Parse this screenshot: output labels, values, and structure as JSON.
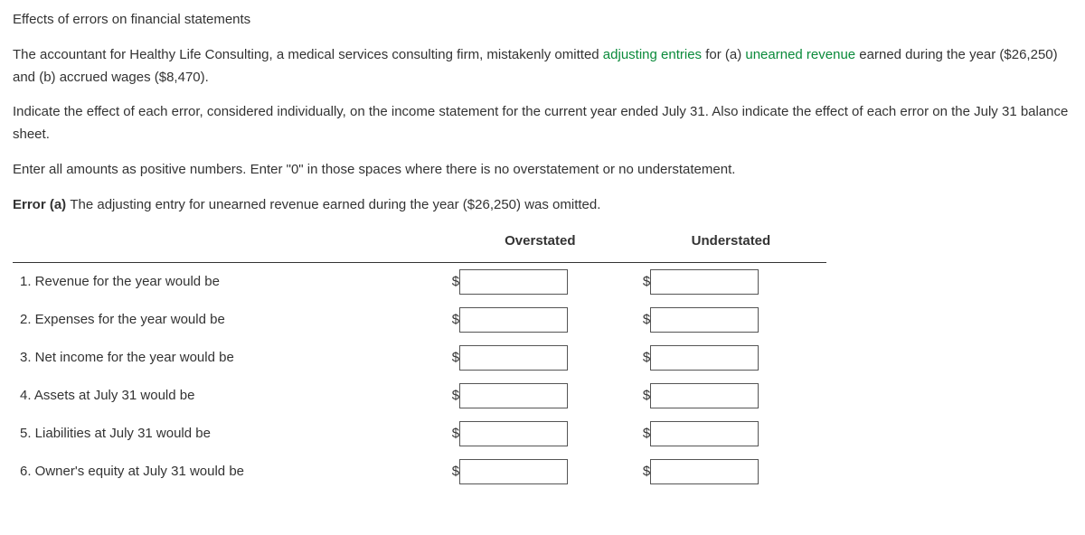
{
  "title": "Effects of errors on financial statements",
  "para1_pre": "The accountant for Healthy Life Consulting, a medical services consulting firm, mistakenly omitted ",
  "link1": "adjusting entries",
  "para1_mid": " for (a) ",
  "link2": "unearned revenue",
  "para1_post": " earned during the year ($26,250) and (b) accrued wages ($8,470).",
  "para2": "Indicate the effect of each error, considered individually, on the income statement for the current year ended July 31. Also indicate the effect of each error on the July 31 balance sheet.",
  "para3": "Enter all amounts as positive numbers. Enter \"0\" in those spaces where there is no overstatement or no understatement.",
  "error_a_label": "Error (a) ",
  "error_a_text": "The adjusting entry for unearned revenue earned during the year ($26,250) was omitted.",
  "columns": {
    "overstated": "Overstated",
    "understated": "Understated"
  },
  "currency": "$",
  "rows": [
    {
      "label": "1. Revenue for the year would be",
      "over": "",
      "under": ""
    },
    {
      "label": "2. Expenses for the year would be",
      "over": "",
      "under": ""
    },
    {
      "label": "3. Net income for the year would be",
      "over": "",
      "under": ""
    },
    {
      "label": "4. Assets at July 31 would be",
      "over": "",
      "under": ""
    },
    {
      "label": "5. Liabilities at July 31 would be",
      "over": "",
      "under": ""
    },
    {
      "label": "6. Owner's equity at July 31 would be",
      "over": "",
      "under": ""
    }
  ]
}
